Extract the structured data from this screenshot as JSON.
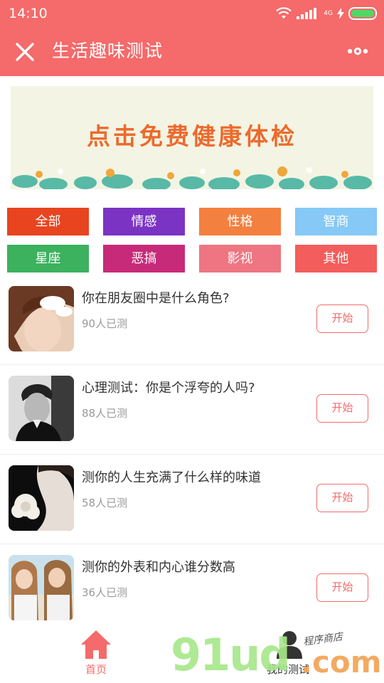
{
  "status_bar": {
    "time": "14:10",
    "network": "4G",
    "battery_level": 1.0
  },
  "header": {
    "title": "生活趣味测试",
    "close_icon": "close-icon",
    "more_icon": "more-dots-icon"
  },
  "banner": {
    "text": "点击免费健康体检"
  },
  "categories": [
    {
      "label": "全部",
      "color": "#e8441f"
    },
    {
      "label": "情感",
      "color": "#7b33c4"
    },
    {
      "label": "性格",
      "color": "#f4803f"
    },
    {
      "label": "智商",
      "color": "#86c9f6"
    },
    {
      "label": "星座",
      "color": "#3cb15e"
    },
    {
      "label": "恶搞",
      "color": "#c72a79"
    },
    {
      "label": "影视",
      "color": "#ee7581"
    },
    {
      "label": "其他",
      "color": "#f35d5b"
    }
  ],
  "tests": [
    {
      "title": "你在朋友圈中是什么角色?",
      "count": "90人已测",
      "button": "开始"
    },
    {
      "title": "心理测试：你是个浮夸的人吗?",
      "count": "88人已测",
      "button": "开始"
    },
    {
      "title": "测你的人生充满了什么样的味道",
      "count": "58人已测",
      "button": "开始"
    },
    {
      "title": "测你的外表和内心谁分数高",
      "count": "36人已测",
      "button": "开始"
    }
  ],
  "tabbar": {
    "home": {
      "label": "首页",
      "icon": "home-icon",
      "color": "#f56a6a"
    },
    "mine": {
      "label": "我的测试",
      "icon": "user-icon",
      "color": "#333333"
    }
  },
  "watermark": {
    "brand": "91ud",
    "domain": ".com",
    "script": "程序商店"
  },
  "colors": {
    "accent": "#f56a6a"
  }
}
